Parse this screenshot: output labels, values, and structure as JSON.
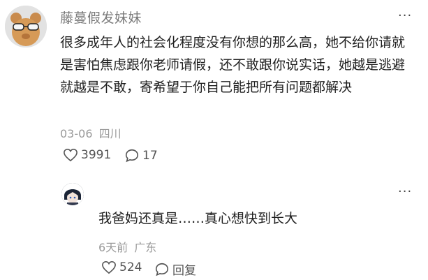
{
  "comment": {
    "username": "藤蔓假发妹妹",
    "text": "很多成年人的社会化程度没有你想的那么高，她不给你请就是害怕焦虑跟你老师请假，还不敢跟你说实话，她越是逃避就越是不敢，寄希望于你自己能把所有问题都解决",
    "date": "03-06",
    "location": "四川",
    "likes": "3991",
    "replies": "17",
    "more_icon": "ellipsis-icon",
    "like_icon": "heart-icon",
    "reply_icon": "comment-icon"
  },
  "reply": {
    "text": "我爸妈还真是……真心想快到长大",
    "date": "6天前",
    "location": "广东",
    "likes": "524",
    "reply_label": "回复",
    "more_icon": "ellipsis-icon"
  }
}
